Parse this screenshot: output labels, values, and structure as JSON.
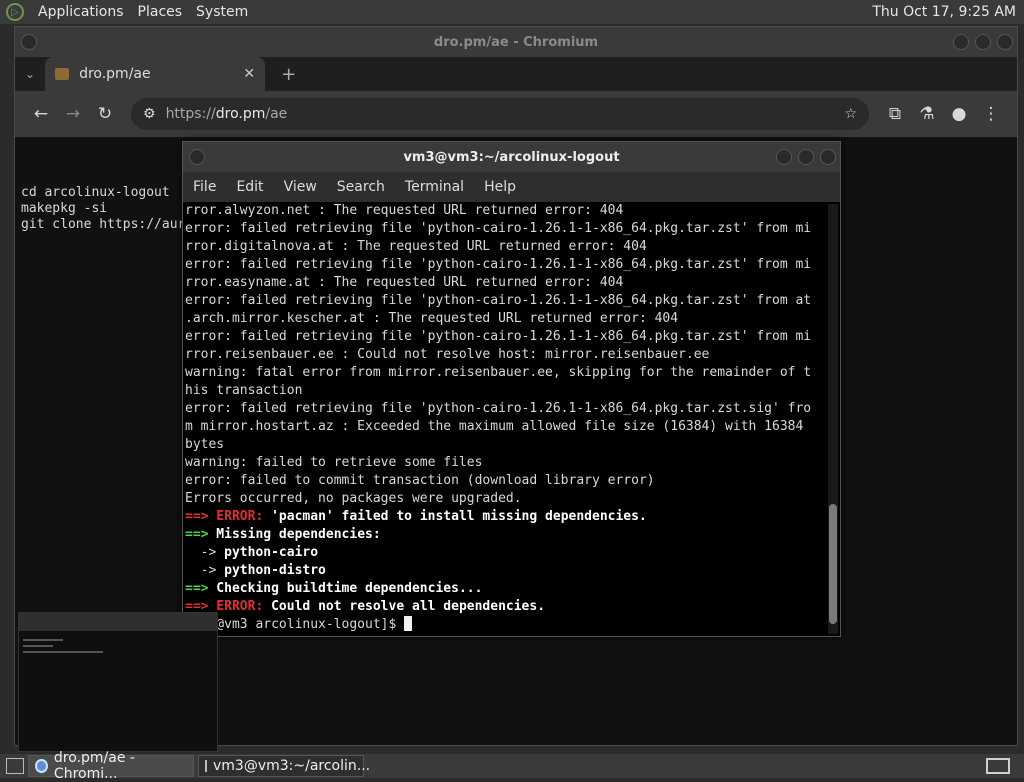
{
  "top_panel": {
    "menus": [
      "Applications",
      "Places",
      "System"
    ],
    "clock": "Thu Oct 17,  9:25 AM"
  },
  "chromium": {
    "window_title": "dro.pm/ae - Chromium",
    "tab_title": "dro.pm/ae",
    "new_tab": "+",
    "url_scheme": "https://",
    "url_host": "dro.pm",
    "url_path": "/ae",
    "page_text": [
      "cd arcolinux-logout",
      "makepkg -si",
      "",
      "git clone https://aur"
    ],
    "icons": {
      "back": "arrow-left",
      "forward": "arrow-right",
      "reload": "reload",
      "site_settings": "tune",
      "bookmark": "star",
      "extensions": "puzzle",
      "labs": "flask",
      "profile": "person",
      "menu": "three-dots"
    }
  },
  "terminal": {
    "window_title": "vm3@vm3:~/arcolinux-logout",
    "menu": [
      "File",
      "Edit",
      "View",
      "Search",
      "Terminal",
      "Help"
    ],
    "lines": [
      {
        "segments": [
          {
            "text": "rror.alwyzon.net : The requested URL returned error: 404",
            "style": "normal"
          }
        ]
      },
      {
        "segments": [
          {
            "text": "error: failed retrieving file 'python-cairo-1.26.1-1-x86_64.pkg.tar.zst' from mi",
            "style": "normal"
          }
        ]
      },
      {
        "segments": [
          {
            "text": "rror.digitalnova.at : The requested URL returned error: 404",
            "style": "normal"
          }
        ]
      },
      {
        "segments": [
          {
            "text": "error: failed retrieving file 'python-cairo-1.26.1-1-x86_64.pkg.tar.zst' from mi",
            "style": "normal"
          }
        ]
      },
      {
        "segments": [
          {
            "text": "rror.easyname.at : The requested URL returned error: 404",
            "style": "normal"
          }
        ]
      },
      {
        "segments": [
          {
            "text": "error: failed retrieving file 'python-cairo-1.26.1-1-x86_64.pkg.tar.zst' from at",
            "style": "normal"
          }
        ]
      },
      {
        "segments": [
          {
            "text": ".arch.mirror.kescher.at : The requested URL returned error: 404",
            "style": "normal"
          }
        ]
      },
      {
        "segments": [
          {
            "text": "error: failed retrieving file 'python-cairo-1.26.1-1-x86_64.pkg.tar.zst' from mi",
            "style": "normal"
          }
        ]
      },
      {
        "segments": [
          {
            "text": "rror.reisenbauer.ee : Could not resolve host: mirror.reisenbauer.ee",
            "style": "normal"
          }
        ]
      },
      {
        "segments": [
          {
            "text": "warning: fatal error from mirror.reisenbauer.ee, skipping for the remainder of t",
            "style": "normal"
          }
        ]
      },
      {
        "segments": [
          {
            "text": "his transaction",
            "style": "normal"
          }
        ]
      },
      {
        "segments": [
          {
            "text": "error: failed retrieving file 'python-cairo-1.26.1-1-x86_64.pkg.tar.zst.sig' fro",
            "style": "normal"
          }
        ]
      },
      {
        "segments": [
          {
            "text": "m mirror.hostart.az : Exceeded the maximum allowed file size (16384) with 16384",
            "style": "normal"
          }
        ]
      },
      {
        "segments": [
          {
            "text": "bytes",
            "style": "normal"
          }
        ]
      },
      {
        "segments": [
          {
            "text": "warning: failed to retrieve some files",
            "style": "normal"
          }
        ]
      },
      {
        "segments": [
          {
            "text": "error: failed to commit transaction (download library error)",
            "style": "normal"
          }
        ]
      },
      {
        "segments": [
          {
            "text": "Errors occurred, no packages were upgraded.",
            "style": "normal"
          }
        ]
      },
      {
        "segments": [
          {
            "text": "==> ERROR:",
            "style": "red"
          },
          {
            "text": " 'pacman' failed to install missing dependencies.",
            "style": "bold"
          }
        ]
      },
      {
        "segments": [
          {
            "text": "==>",
            "style": "green"
          },
          {
            "text": " Missing dependencies:",
            "style": "bold"
          }
        ]
      },
      {
        "segments": [
          {
            "text": "  -> ",
            "style": "normal"
          },
          {
            "text": "python-cairo",
            "style": "bold"
          }
        ]
      },
      {
        "segments": [
          {
            "text": "  -> ",
            "style": "normal"
          },
          {
            "text": "python-distro",
            "style": "bold"
          }
        ]
      },
      {
        "segments": [
          {
            "text": "==>",
            "style": "green"
          },
          {
            "text": " Checking buildtime dependencies...",
            "style": "bold"
          }
        ]
      },
      {
        "segments": [
          {
            "text": "==> ERROR:",
            "style": "red"
          },
          {
            "text": " Could not resolve all dependencies.",
            "style": "bold"
          }
        ]
      },
      {
        "segments": [
          {
            "text": "[vm3@vm3 arcolinux-logout]$ ",
            "style": "normal"
          }
        ]
      }
    ]
  },
  "taskbar": {
    "tasks": [
      {
        "label": "dro.pm/ae - Chromi...",
        "icon": "chromium-icon"
      },
      {
        "label": "vm3@vm3:~/arcolin...",
        "icon": "terminal-icon"
      }
    ]
  }
}
